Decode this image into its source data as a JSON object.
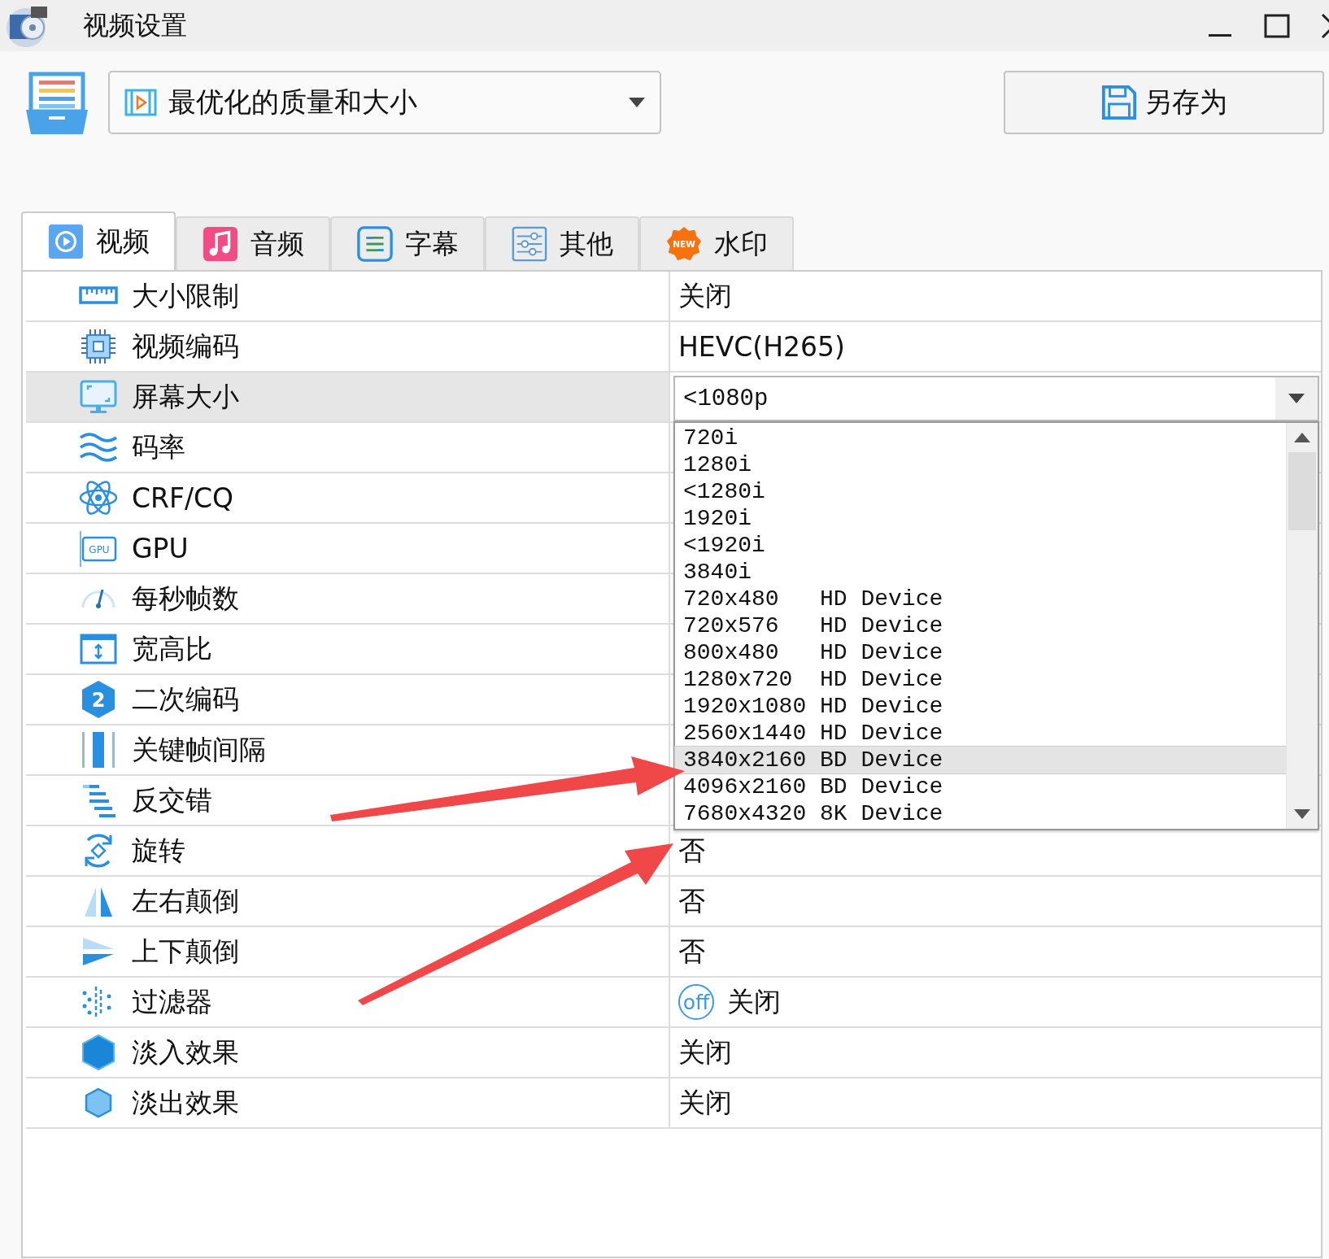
{
  "window": {
    "title": "视频设置"
  },
  "preset": {
    "value": "最优化的质量和大小"
  },
  "save_button": {
    "label": "另存为"
  },
  "tabs": [
    {
      "label": "视频",
      "selected": true
    },
    {
      "label": "音频",
      "selected": false
    },
    {
      "label": "字幕",
      "selected": false
    },
    {
      "label": "其他",
      "selected": false
    },
    {
      "label": "水印",
      "selected": false,
      "badge": "NEW"
    }
  ],
  "rows": [
    {
      "name": "大小限制",
      "kind": "text",
      "value": "关闭",
      "selected": false
    },
    {
      "name": "视频编码",
      "kind": "text",
      "value": "HEVC(H265)",
      "selected": false
    },
    {
      "name": "屏幕大小",
      "kind": "combo",
      "value": "<1080p",
      "expanded": true,
      "selected": true,
      "options": [
        {
          "label": "720i",
          "selected": false
        },
        {
          "label": "1280i",
          "selected": false
        },
        {
          "label": "<1280i",
          "selected": false
        },
        {
          "label": "1920i",
          "selected": false
        },
        {
          "label": "<1920i",
          "selected": false
        },
        {
          "label": "3840i",
          "selected": false
        },
        {
          "label": "720x480   HD Device",
          "selected": false
        },
        {
          "label": "720x576   HD Device",
          "selected": false
        },
        {
          "label": "800x480   HD Device",
          "selected": false
        },
        {
          "label": "1280x720  HD Device",
          "selected": false
        },
        {
          "label": "1920x1080 HD Device",
          "selected": false
        },
        {
          "label": "2560x1440 HD Device",
          "selected": false
        },
        {
          "label": "3840x2160 BD Device",
          "selected": true
        },
        {
          "label": "4096x2160 BD Device",
          "selected": false
        },
        {
          "label": "7680x4320 8K Device",
          "selected": false
        }
      ]
    },
    {
      "name": "码率",
      "kind": "text",
      "selected": false
    },
    {
      "name": "CRF/CQ",
      "kind": "text",
      "selected": false
    },
    {
      "name": "GPU",
      "kind": "text",
      "selected": false,
      "icon_text": "GPU"
    },
    {
      "name": "每秒帧数",
      "kind": "text",
      "selected": false
    },
    {
      "name": "宽高比",
      "kind": "text",
      "selected": false
    },
    {
      "name": "二次编码",
      "kind": "text",
      "selected": false,
      "icon_text": "2"
    },
    {
      "name": "关键帧间隔",
      "kind": "text",
      "selected": false
    },
    {
      "name": "反交错",
      "kind": "text",
      "selected": false
    },
    {
      "name": "旋转",
      "kind": "text",
      "value": "否",
      "selected": false
    },
    {
      "name": "左右颠倒",
      "kind": "text",
      "value": "否",
      "selected": false
    },
    {
      "name": "上下颠倒",
      "kind": "text",
      "value": "否",
      "selected": false
    },
    {
      "name": "过滤器",
      "kind": "toggle",
      "on": false,
      "toggle_label": "off",
      "value": "关闭",
      "selected": false
    },
    {
      "name": "淡入效果",
      "kind": "text",
      "value": "关闭",
      "selected": false
    },
    {
      "name": "淡出效果",
      "kind": "text",
      "value": "关闭",
      "selected": false
    }
  ]
}
